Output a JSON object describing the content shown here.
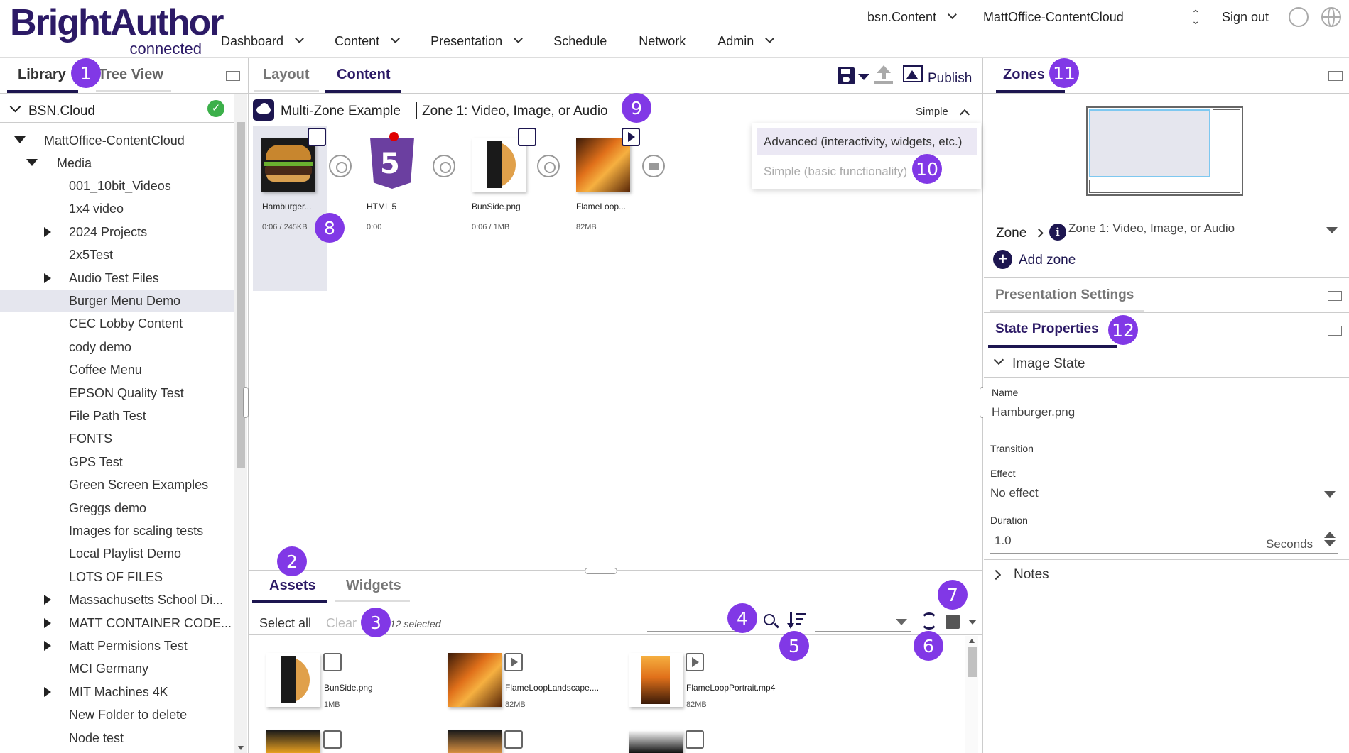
{
  "header": {
    "logo_main": "BrightAuthor",
    "logo_sub": "connected",
    "nav": [
      "Dashboard",
      "Content",
      "Presentation",
      "Schedule",
      "Network",
      "Admin"
    ],
    "account_selector": "bsn.Content",
    "network_selector": "MattOffice-ContentCloud",
    "sign_out": "Sign out"
  },
  "left_panel": {
    "tabs": [
      "Library",
      "Tree View"
    ],
    "root_label": "BSN.Cloud",
    "network_node": "MattOffice-ContentCloud",
    "media_node": "Media",
    "items": [
      {
        "label": "001_10bit_Videos",
        "expandable": false
      },
      {
        "label": "1x4 video",
        "expandable": false
      },
      {
        "label": "2024 Projects",
        "expandable": true
      },
      {
        "label": "2x5Test",
        "expandable": false
      },
      {
        "label": "Audio Test Files",
        "expandable": true
      },
      {
        "label": "Burger Menu Demo",
        "expandable": false,
        "selected": true
      },
      {
        "label": "CEC Lobby Content",
        "expandable": false
      },
      {
        "label": "cody demo",
        "expandable": false
      },
      {
        "label": "Coffee Menu",
        "expandable": false
      },
      {
        "label": "EPSON Quality Test",
        "expandable": false
      },
      {
        "label": "File Path Test",
        "expandable": false
      },
      {
        "label": "FONTS",
        "expandable": false
      },
      {
        "label": "GPS Test",
        "expandable": false
      },
      {
        "label": "Green Screen Examples",
        "expandable": false
      },
      {
        "label": "Greggs demo",
        "expandable": false
      },
      {
        "label": "Images for scaling tests",
        "expandable": false
      },
      {
        "label": "Local Playlist Demo",
        "expandable": false
      },
      {
        "label": "LOTS OF FILES",
        "expandable": false
      },
      {
        "label": "Massachusetts School Di...",
        "expandable": true
      },
      {
        "label": "MATT CONTAINER CODE...",
        "expandable": true
      },
      {
        "label": "Matt Permisions Test",
        "expandable": true
      },
      {
        "label": "MCI Germany",
        "expandable": false
      },
      {
        "label": "MIT Machines 4K",
        "expandable": true
      },
      {
        "label": "New Folder to delete",
        "expandable": false
      },
      {
        "label": "Node test",
        "expandable": false
      }
    ]
  },
  "center": {
    "tabs": [
      "Layout",
      "Content"
    ],
    "publish_label": "Publish",
    "presentation_name": "Multi-Zone Example",
    "zone_name": "Zone 1: Video, Image, or Audio",
    "mode_label": "Simple",
    "mode_options": [
      "Advanced (interactivity, widgets, etc.)",
      "Simple (basic functionality)"
    ],
    "playlist": [
      {
        "name": "Hamburger...",
        "meta": "0:06 / 245KB",
        "type": "image-icon"
      },
      {
        "name": "HTML 5",
        "meta": "0:00",
        "type": "html5-icon"
      },
      {
        "name": "BunSide.png",
        "meta": "0:06 / 1MB",
        "type": "image-icon"
      },
      {
        "name": "FlameLoop...",
        "meta": "82MB",
        "type": "video-icon"
      }
    ],
    "bottom_tabs": [
      "Assets",
      "Widgets"
    ],
    "select_all": "Select all",
    "clear": "Clear",
    "selected_count": "12 selected",
    "assets": [
      {
        "name": "BunSide.png",
        "size": "1MB",
        "type": "image-icon"
      },
      {
        "name": "FlameLoopLandscape....",
        "size": "82MB",
        "type": "video-icon"
      },
      {
        "name": "FlameLoopPortrait.mp4",
        "size": "82MB",
        "type": "video-icon"
      }
    ]
  },
  "right_panel": {
    "zones_tab": "Zones",
    "zone_label": "Zone",
    "zone_select": "Zone 1: Video, Image, or Audio",
    "add_zone": "Add zone",
    "presentation_settings": "Presentation Settings",
    "state_properties": "State Properties",
    "image_state": "Image State",
    "name_label": "Name",
    "name_value": "Hamburger.png",
    "transition_label": "Transition",
    "effect_label": "Effect",
    "effect_value": "No effect",
    "duration_label": "Duration",
    "duration_value": "1.0",
    "duration_unit": "Seconds",
    "notes_label": "Notes"
  },
  "annotations": [
    "1",
    "2",
    "3",
    "4",
    "5",
    "6",
    "7",
    "8",
    "9",
    "10",
    "11",
    "12"
  ],
  "colors": {
    "brand": "#2c1a66",
    "accent": "#8138e6",
    "tab_underline": "#1d1650",
    "success": "#3cb04a",
    "badge_red": "#e00000"
  }
}
